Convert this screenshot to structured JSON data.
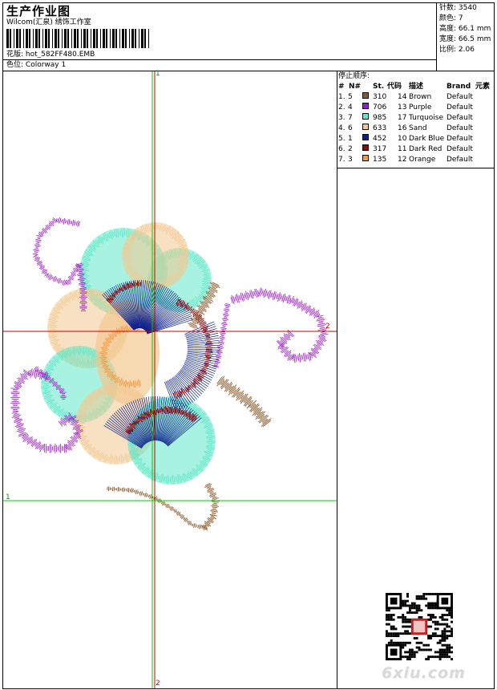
{
  "header": {
    "title": "生产作业图",
    "company": "Wilcom(汇泉) 绣饰工作室",
    "design_label": "花版:",
    "design_value": "hot_582FF480.EMB",
    "colorway_label": "色位:",
    "colorway_value": "Colorway 1"
  },
  "stats": [
    {
      "label": "针数:",
      "value": "3540"
    },
    {
      "label": "颜色:",
      "value": "7"
    },
    {
      "label": "高度:",
      "value": "66.1 mm"
    },
    {
      "label": "宽度:",
      "value": "66.5 mm"
    },
    {
      "label": "比例:",
      "value": "2.06"
    }
  ],
  "stop_sequence": {
    "title": "停止顺序:",
    "columns": [
      "#",
      "N#",
      "St.",
      "代码",
      "描述",
      "Brand",
      "元素"
    ],
    "rows": [
      {
        "index": "1.",
        "n": "5",
        "color": "#8B5A2B",
        "code": "310",
        "num": "14",
        "desc": "Brown",
        "brand": "Default"
      },
      {
        "index": "2.",
        "n": "4",
        "color": "#9B1FC8",
        "code": "706",
        "num": "13",
        "desc": "Purple",
        "brand": "Default"
      },
      {
        "index": "3.",
        "n": "7",
        "color": "#60E8C8",
        "code": "985",
        "num": "17",
        "desc": "Turquoise",
        "brand": "Default"
      },
      {
        "index": "4.",
        "n": "6",
        "color": "#F2C890",
        "code": "633",
        "num": "16",
        "desc": "Sand",
        "brand": "Default"
      },
      {
        "index": "5.",
        "n": "1",
        "color": "#0A1E8C",
        "code": "452",
        "num": "10",
        "desc": "Dark Blue",
        "brand": "Default"
      },
      {
        "index": "6.",
        "n": "2",
        "color": "#8E0A0A",
        "code": "317",
        "num": "11",
        "desc": "Dark Red",
        "brand": "Default"
      },
      {
        "index": "7.",
        "n": "3",
        "color": "#F79A40",
        "code": "135",
        "num": "12",
        "desc": "Orange",
        "brand": "Default"
      }
    ]
  },
  "guides": {
    "v_top": "1",
    "v_bottom": "2",
    "h_left": "1",
    "h_right": "2"
  },
  "watermark": "6xiu.com"
}
